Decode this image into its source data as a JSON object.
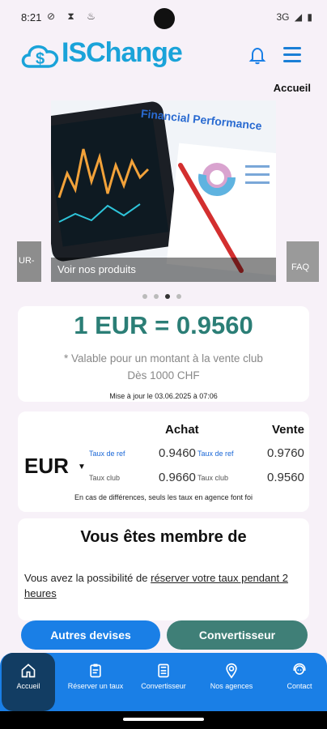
{
  "status": {
    "time": "8:21",
    "network": "3G"
  },
  "header": {
    "brand": "ISChange"
  },
  "breadcrumb": "Accueil",
  "carousel": {
    "caption": "Voir nos produits",
    "left_peek": "UR-",
    "right_peek": "FAQ",
    "image_title": "Financial Performance",
    "dots": 4,
    "active_dot": 2
  },
  "rate": {
    "main": "1 EUR = 0.9560",
    "note_line1": "* Valable pour un montant à la vente club",
    "note_line2": "Dès 1000 CHF",
    "updated": "Mise à jour le 03.06.2025 à 07:06"
  },
  "table": {
    "col_buy": "Achat",
    "col_sell": "Vente",
    "currency": "EUR",
    "ref_label": "Taux de ref",
    "club_label": "Taux club",
    "ref_buy": "0.9460",
    "ref_sell": "0.9760",
    "club_buy": "0.9660",
    "club_sell": "0.9560",
    "note": "En cas de différences, seuls les taux en agence font foi"
  },
  "member": {
    "title": "Vous êtes membre de",
    "text": "Vous avez la possibilité de ",
    "link": "réserver votre taux pendant 2 heures"
  },
  "buttons": {
    "other": "Autres devises",
    "converter": "Convertisseur"
  },
  "nav": {
    "home": "Accueil",
    "reserve": "Réserver un taux",
    "converter": "Convertisseur",
    "agencies": "Nos agences",
    "contact": "Contact"
  },
  "colors": {
    "primary": "#1a7fe6",
    "teal": "#2b7e76",
    "nav_active": "#123d63"
  }
}
